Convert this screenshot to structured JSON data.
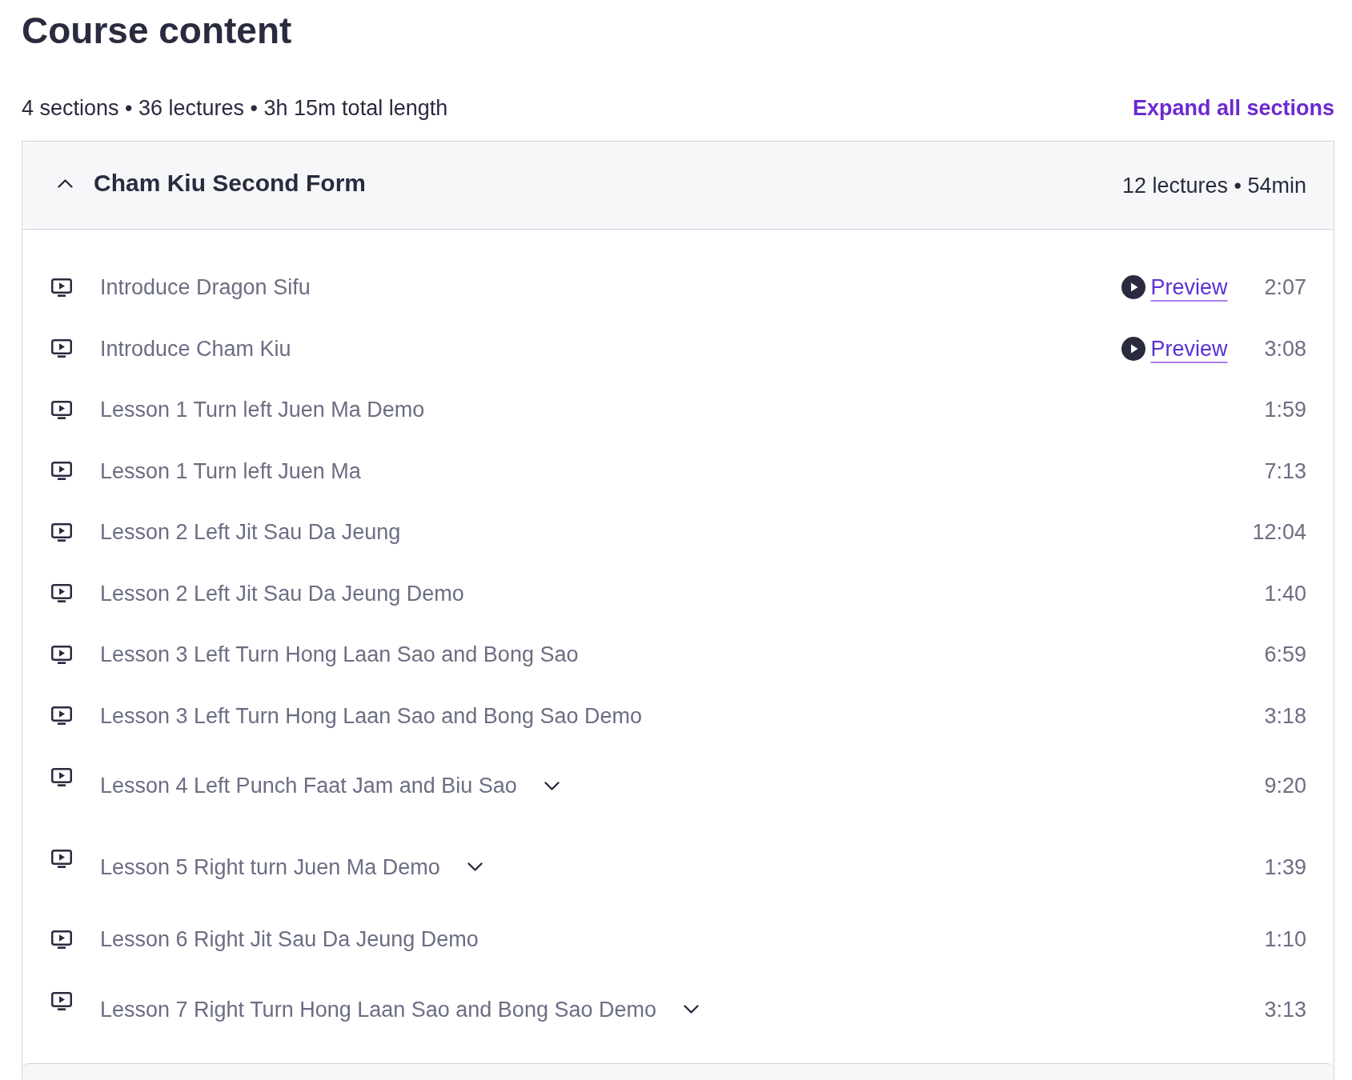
{
  "page": {
    "title": "Course content",
    "summary": "4 sections • 36 lectures • 3h 15m total length",
    "expand_all": "Expand all sections"
  },
  "sections": [
    {
      "title": "Cham Kiu Second Form",
      "meta": "12 lectures • 54min",
      "expanded": true,
      "lectures": [
        {
          "title": "Introduce Dragon Sifu",
          "preview": "Preview",
          "duration": "2:07",
          "expandable": false
        },
        {
          "title": "Introduce Cham Kiu",
          "preview": "Preview",
          "duration": "3:08",
          "expandable": false
        },
        {
          "title": "Lesson 1 Turn left Juen Ma Demo",
          "duration": "1:59",
          "expandable": false
        },
        {
          "title": "Lesson 1 Turn left Juen Ma",
          "duration": "7:13",
          "expandable": false
        },
        {
          "title": "Lesson 2 Left Jit Sau Da Jeung",
          "duration": "12:04",
          "expandable": false
        },
        {
          "title": "Lesson 2 Left Jit Sau Da Jeung Demo",
          "duration": "1:40",
          "expandable": false
        },
        {
          "title": "Lesson 3 Left Turn Hong Laan Sao and Bong Sao",
          "duration": "6:59",
          "expandable": false
        },
        {
          "title": "Lesson 3 Left Turn Hong Laan Sao and Bong Sao Demo",
          "duration": "3:18",
          "expandable": false
        },
        {
          "title": "Lesson 4 Left Punch Faat Jam and Biu Sao",
          "duration": "9:20",
          "expandable": true
        },
        {
          "title": "Lesson 5 Right turn Juen Ma Demo",
          "duration": "1:39",
          "expandable": true
        },
        {
          "title": "Lesson 6 Right Jit Sau Da Jeung Demo",
          "duration": "1:10",
          "expandable": false
        },
        {
          "title": "Lesson 7 Right Turn Hong Laan Sao and Bong Sao Demo",
          "duration": "3:13",
          "expandable": true
        }
      ]
    }
  ]
}
